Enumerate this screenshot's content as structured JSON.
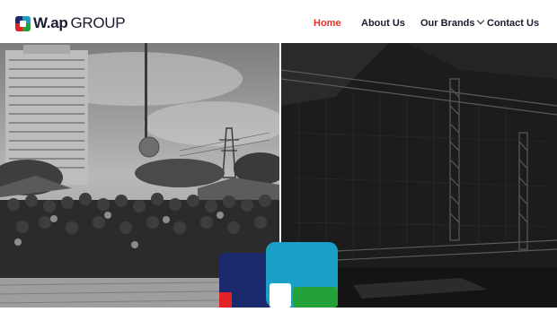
{
  "brand": {
    "name_bold": "W.ap",
    "name_light": "GROUP",
    "colors": {
      "navy": "#1a2a6c",
      "cyan": "#1aa0c6",
      "red": "#e32227",
      "green": "#23a23a"
    }
  },
  "nav": {
    "items": [
      {
        "label": "Home",
        "active": true
      },
      {
        "label": "About Us",
        "active": false
      },
      {
        "label": "Our Brands",
        "active": false,
        "has_dropdown": true
      },
      {
        "label": "Contact Us",
        "active": false
      }
    ],
    "active_color": "#e0322c",
    "text_color": "#1b1b2f"
  },
  "hero": {
    "left_image": "team-group-photo",
    "right_image": "stage-truss-photo",
    "overlay_logo": "wap-group-logo-mark"
  }
}
